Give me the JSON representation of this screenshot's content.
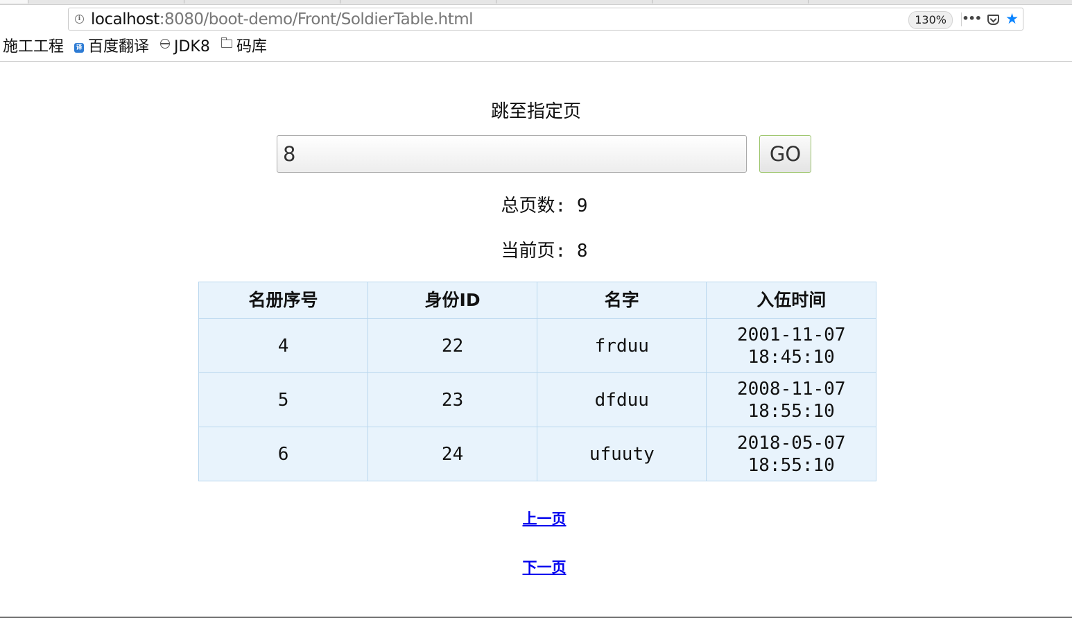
{
  "browser": {
    "url_host": "localhost",
    "url_path": ":8080/boot-demo/Front/SoldierTable.html",
    "zoom": "130%",
    "bookmarks": [
      {
        "label": "施工工程",
        "icon": "none"
      },
      {
        "label": "百度翻译",
        "icon": "translate-icon"
      },
      {
        "label": "JDK8",
        "icon": "globe-icon"
      },
      {
        "label": "码库",
        "icon": "folder-icon"
      }
    ]
  },
  "page": {
    "jump_title": "跳至指定页",
    "page_input_value": "8",
    "go_label": "GO",
    "total_pages_text": "总页数: 9",
    "current_page_text": "当前页: 8",
    "table": {
      "headers": [
        "名册序号",
        "身份ID",
        "名字",
        "入伍时间"
      ],
      "rows": [
        {
          "roster_no": "4",
          "id": "22",
          "name": "frduu",
          "enlist_date": "2001-11-07",
          "enlist_time": "18:45:10"
        },
        {
          "roster_no": "5",
          "id": "23",
          "name": "dfduu",
          "enlist_date": "2008-11-07",
          "enlist_time": "18:55:10"
        },
        {
          "roster_no": "6",
          "id": "24",
          "name": "ufuuty",
          "enlist_date": "2018-05-07",
          "enlist_time": "18:55:10"
        }
      ]
    },
    "prev_label": "上一页",
    "next_label": "下一页"
  },
  "colors": {
    "table_bg": "#e8f3fc",
    "table_border": "#b9d7ee",
    "link": "#0000ee",
    "go_border": "#9bc46a",
    "star": "#0a84ff"
  }
}
